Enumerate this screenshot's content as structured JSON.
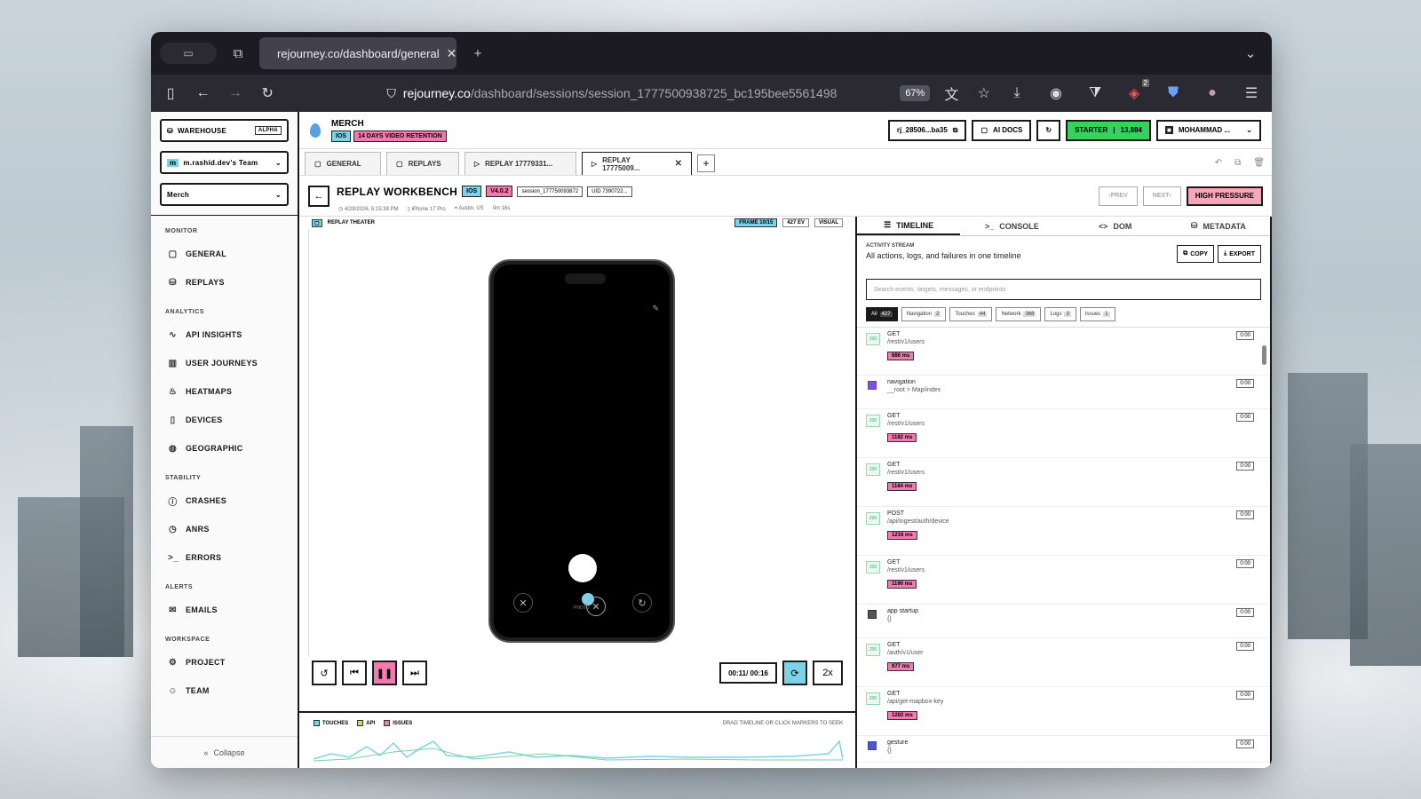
{
  "browser": {
    "tab_title": "rejourney.co/dashboard/general",
    "url_host": "rejourney.co",
    "url_path": "/dashboard/sessions/session_1777500938725_bc195bee5561498",
    "zoom": "67%",
    "notif_count": "2"
  },
  "sidebar": {
    "warehouse": "WAREHOUSE",
    "warehouse_badge": "ALPHA",
    "team": "m.rashid.dev's Team",
    "project": "Merch",
    "groups": {
      "monitor": "MONITOR",
      "analytics": "ANALYTICS",
      "stability": "STABILITY",
      "alerts": "ALERTS",
      "workspace": "WORKSPACE"
    },
    "items": {
      "general": "GENERAL",
      "replays": "REPLAYS",
      "api_insights": "API INSIGHTS",
      "user_journeys": "USER JOURNEYS",
      "heatmaps": "HEATMAPS",
      "devices": "DEVICES",
      "geographic": "GEOGRAPHIC",
      "crashes": "CRASHES",
      "anrs": "ANRS",
      "errors": "ERRORS",
      "emails": "EMAILS",
      "project": "PROJECT",
      "team": "TEAM"
    },
    "collapse": "Collapse"
  },
  "topbar": {
    "project_name": "MERCH",
    "platform": "IOS",
    "retention": "14 DAYS VIDEO RETENTION",
    "key": "rj_28506...ba35",
    "ai_docs": "AI DOCS",
    "plan": "STARTER",
    "plan_count": "13,884",
    "user": "MOHAMMAD ..."
  },
  "page_tabs": {
    "general": "GENERAL",
    "replays": "REPLAYS",
    "replay1": "REPLAY 17779331...",
    "replay2": "REPLAY 17775009..."
  },
  "workbench": {
    "title": "REPLAY WORKBENCH",
    "platform": "IOS",
    "version": "V4.0.2",
    "session": "session_177750093872",
    "uid": "UID 7390722...",
    "date": "4/29/2026, 5:15:38 PM",
    "device": "iPhone 17 Pro",
    "location": "Austin, US",
    "duration": "0m 16s",
    "prev": "PREV",
    "next": "NEXT",
    "pressure": "HIGH PRESSURE"
  },
  "theater": {
    "label": "REPLAY THEATER",
    "frame": "FRAME 10/15",
    "events": "427 EV",
    "visual": "VISUAL",
    "phone_label": "PHOTO",
    "time": "00:11/ 00:16",
    "speed": "2x",
    "legend_touches": "TOUCHES",
    "legend_api": "API",
    "legend_issues": "ISSUES",
    "hint": "DRAG TIMELINE OR CLICK MARKERS TO SEEK"
  },
  "panel": {
    "tabs": {
      "timeline": "TIMELINE",
      "console": "CONSOLE",
      "dom": "DOM",
      "metadata": "METADATA"
    },
    "stream_small": "ACTIVITY STREAM",
    "stream_title": "All actions, logs, and failures in one timeline",
    "copy": "COPY",
    "export": "EXPORT",
    "search_placeholder": "Search events, targets, messages, or endpoints",
    "filters": [
      {
        "label": "All",
        "count": "427"
      },
      {
        "label": "Navigation",
        "count": "2"
      },
      {
        "label": "Touches",
        "count": "44"
      },
      {
        "label": "Network",
        "count": "368"
      },
      {
        "label": "Logs",
        "count": "3"
      },
      {
        "label": "Issues",
        "count": "1"
      }
    ],
    "events": [
      {
        "method": "GET",
        "path": "/rest/v1/users",
        "dur": "686 ms",
        "time": "0:00"
      },
      {
        "method": "navigation",
        "path": "__root > Map/index",
        "dur": "",
        "time": "0:00"
      },
      {
        "method": "GET",
        "path": "/rest/v1/users",
        "dur": "1182 ms",
        "time": "0:00"
      },
      {
        "method": "GET",
        "path": "/rest/v1/users",
        "dur": "1184 ms",
        "time": "0:00"
      },
      {
        "method": "POST",
        "path": "/api/ingest/auth/device",
        "dur": "1216 ms",
        "time": "0:00"
      },
      {
        "method": "GET",
        "path": "/rest/v1/users",
        "dur": "1190 ms",
        "time": "0:00"
      },
      {
        "method": "app startup",
        "path": "{}",
        "dur": "",
        "time": "0:00"
      },
      {
        "method": "GET",
        "path": "/auth/v1/user",
        "dur": "977 ms",
        "time": "0:00"
      },
      {
        "method": "GET",
        "path": "/api/get-mapbox-key",
        "dur": "1282 ms",
        "time": "0:00"
      },
      {
        "method": "gesture",
        "path": "{}",
        "dur": "",
        "time": "0:00"
      }
    ]
  }
}
